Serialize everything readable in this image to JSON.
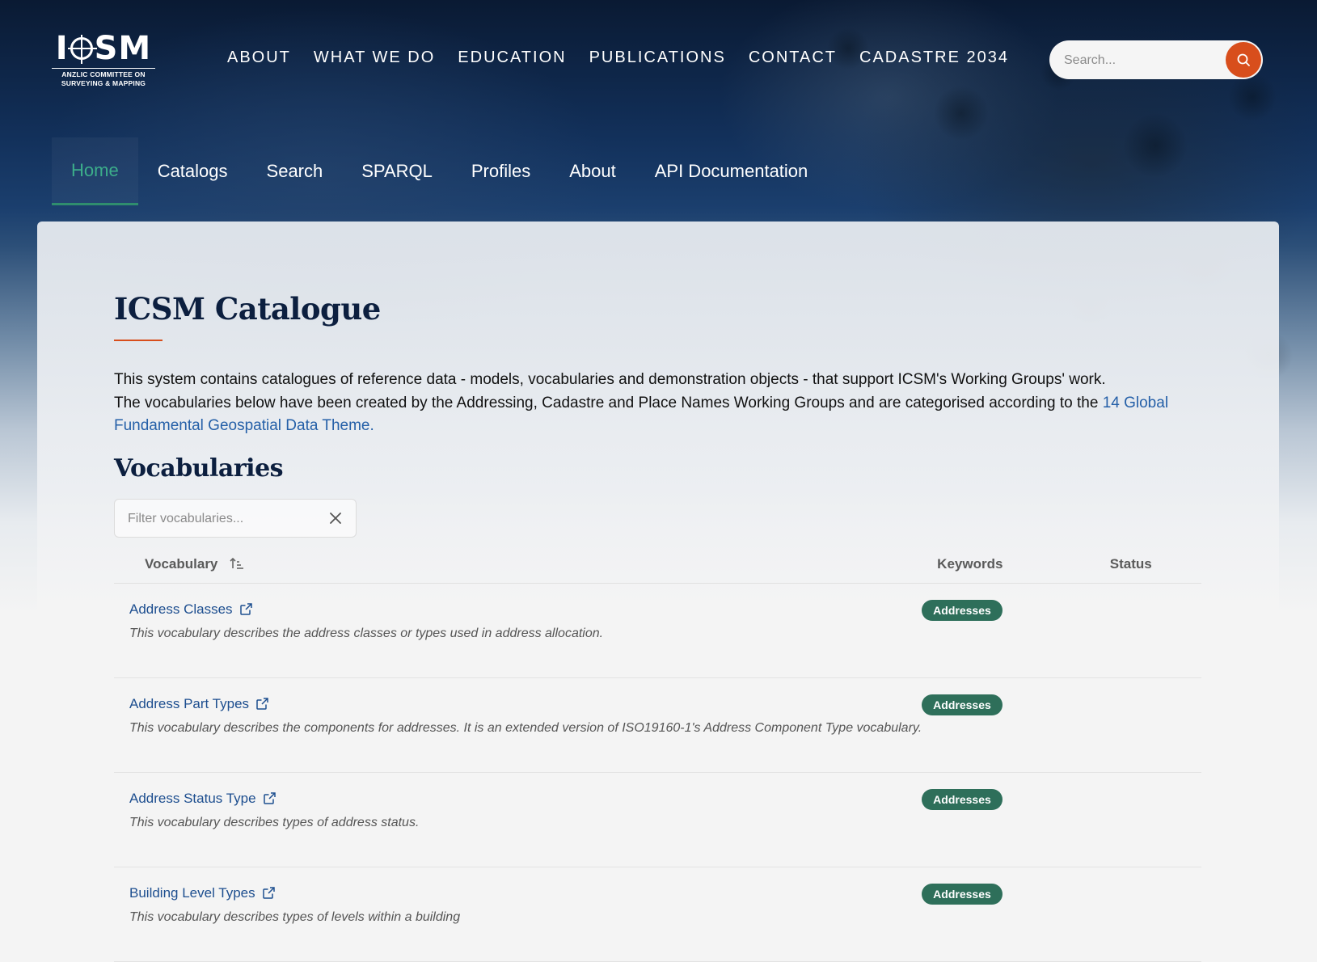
{
  "brand": {
    "logo_text_left": "I",
    "logo_text_right": "SM",
    "logo_sub_line1": "ANZLIC COMMITTEE ON",
    "logo_sub_line2": "SURVEYING & MAPPING"
  },
  "main_nav": [
    {
      "label": "ABOUT"
    },
    {
      "label": "WHAT WE DO"
    },
    {
      "label": "EDUCATION"
    },
    {
      "label": "PUBLICATIONS"
    },
    {
      "label": "CONTACT"
    },
    {
      "label": "CADASTRE 2034"
    }
  ],
  "search": {
    "placeholder": "Search..."
  },
  "sub_nav": [
    {
      "label": "Home",
      "active": true
    },
    {
      "label": "Catalogs"
    },
    {
      "label": "Search"
    },
    {
      "label": "SPARQL"
    },
    {
      "label": "Profiles"
    },
    {
      "label": "About"
    },
    {
      "label": "API Documentation"
    }
  ],
  "page": {
    "title": "ICSM Catalogue",
    "intro_line1": "This system contains catalogues of reference data - models, vocabularies and demonstration objects - that support ICSM's Working Groups' work.",
    "intro_line2": "The vocabularies below have been created by the Addressing, Cadastre and Place Names Working Groups and are categorised according to the ",
    "intro_link": "14 Global Fundamental Geospatial Data Theme.",
    "vocab_heading": "Vocabularies",
    "filter_placeholder": "Filter vocabularies..."
  },
  "table": {
    "headers": {
      "vocabulary": "Vocabulary",
      "keywords": "Keywords",
      "status": "Status"
    },
    "rows": [
      {
        "name": "Address Classes",
        "desc": "This vocabulary describes the address classes or types used in address allocation.",
        "keyword": "Addresses"
      },
      {
        "name": "Address Part Types",
        "desc": "This vocabulary describes the components for addresses. It is an extended version of ISO19160-1's Address Component Type vocabulary.",
        "keyword": "Addresses"
      },
      {
        "name": "Address Status Type",
        "desc": "This vocabulary describes types of address status.",
        "keyword": "Addresses"
      },
      {
        "name": "Building Level Types",
        "desc": "This vocabulary describes types of levels within a building",
        "keyword": "Addresses"
      }
    ]
  },
  "colors": {
    "accent": "#d84e1c",
    "nav_active": "#3cae8a",
    "badge": "#2e6f5a",
    "link": "#1d4e8f",
    "heading": "#0c1f3f"
  }
}
